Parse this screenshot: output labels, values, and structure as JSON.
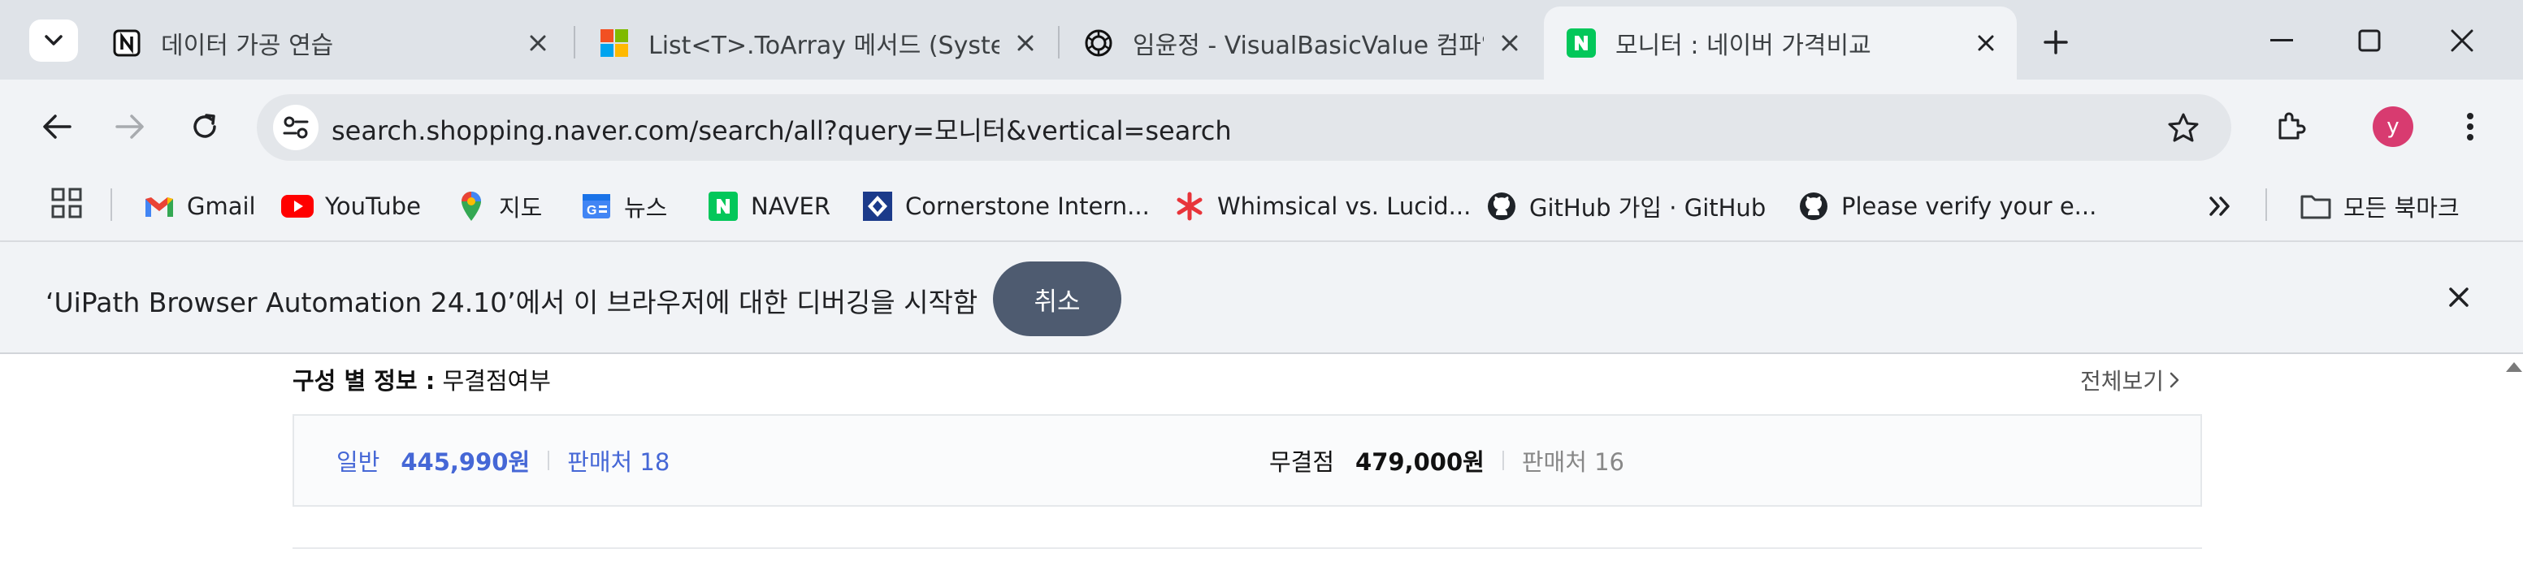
{
  "tabs": [
    {
      "title": "데이터 가공 연습",
      "favicon": "notion-icon"
    },
    {
      "title": "List<T>.ToArray 메서드 (System.Collections.Generic)",
      "favicon": "microsoft-icon"
    },
    {
      "title": "임윤정 - VisualBasicValue 컴파일",
      "favicon": "openai-icon"
    },
    {
      "title": "모니터 : 네이버 가격비교",
      "favicon": "naver-icon",
      "active": true
    }
  ],
  "toolbar": {
    "url": "search.shopping.naver.com/search/all?query=모니터&vertical=search",
    "profile_initial": "y",
    "profile_color": "#d83b70"
  },
  "bookmarks": [
    {
      "label": "Gmail",
      "icon": "gmail-icon"
    },
    {
      "label": "YouTube",
      "icon": "youtube-icon"
    },
    {
      "label": "지도",
      "icon": "maps-pin-icon"
    },
    {
      "label": "뉴스",
      "icon": "news-icon"
    },
    {
      "label": "NAVER",
      "icon": "naver-icon"
    },
    {
      "label": "Cornerstone Intern...",
      "icon": "cornerstone-icon"
    },
    {
      "label": "Whimsical vs. Lucid...",
      "icon": "whimsical-icon"
    },
    {
      "label": "GitHub 가입 · GitHub",
      "icon": "github-icon"
    },
    {
      "label": "Please verify your e...",
      "icon": "github-icon"
    }
  ],
  "all_bookmarks_label": "모든 북마크",
  "infobar": {
    "message": "‘UiPath Browser Automation 24.10’에서 이 브라우저에 대한 디버깅을 시작함",
    "cancel_label": "취소"
  },
  "content": {
    "section_title_bold": "구성 별 정보 :",
    "section_title_rest": " 무결점여부",
    "see_all": "전체보기",
    "general": {
      "label": "일반",
      "price": "445,990원",
      "sellers": "판매처 18"
    },
    "flawless": {
      "label": "무결점",
      "price": "479,000원",
      "sellers": "판매처 16"
    }
  },
  "colors": {
    "accent_blue": "#4567d6",
    "infobar_button": "#4e5b70",
    "tabstrip": "#dfe3e8",
    "toolbar": "#f1f3f6"
  }
}
